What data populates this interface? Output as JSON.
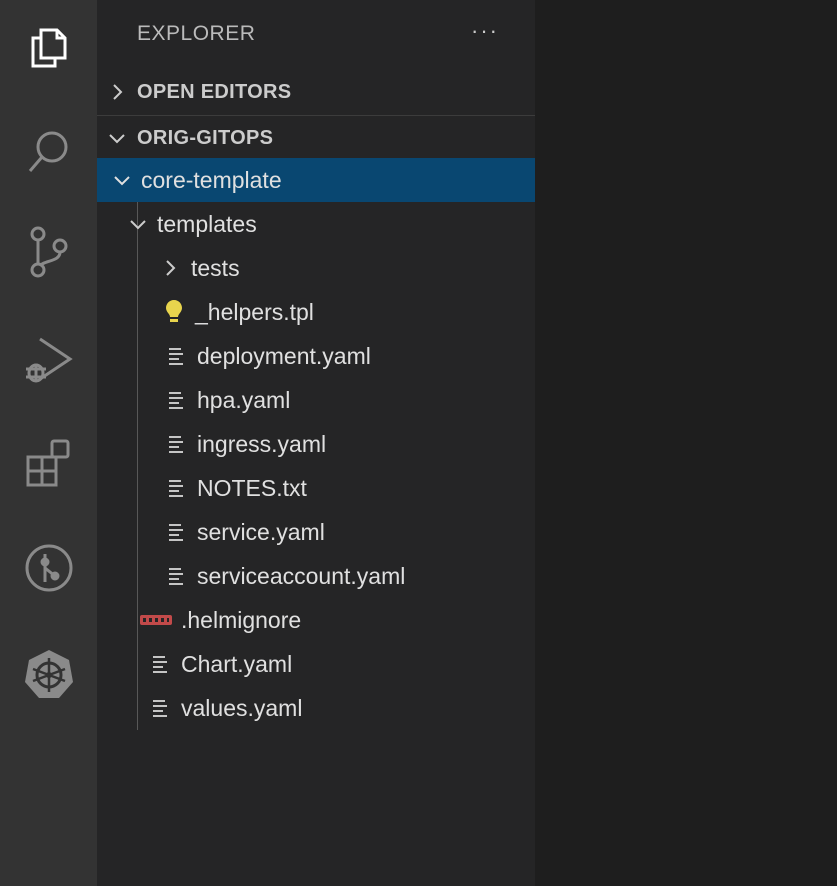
{
  "sidebar": {
    "title": "EXPLORER",
    "more_actions": "···",
    "open_editors_label": "OPEN EDITORS",
    "workspace_label": "ORIG-GITOPS"
  },
  "tree": {
    "core_template": "core-template",
    "templates": "templates",
    "tests": "tests",
    "helpers": "_helpers.tpl",
    "deployment": "deployment.yaml",
    "hpa": "hpa.yaml",
    "ingress": "ingress.yaml",
    "notes": "NOTES.txt",
    "service": "service.yaml",
    "serviceaccount": "serviceaccount.yaml",
    "helmignore": ".helmignore",
    "chart": "Chart.yaml",
    "values": "values.yaml"
  },
  "colors": {
    "selection": "#094771",
    "helmignore_icon": "#c24a4a",
    "helpers_icon": "#e8d44d"
  }
}
